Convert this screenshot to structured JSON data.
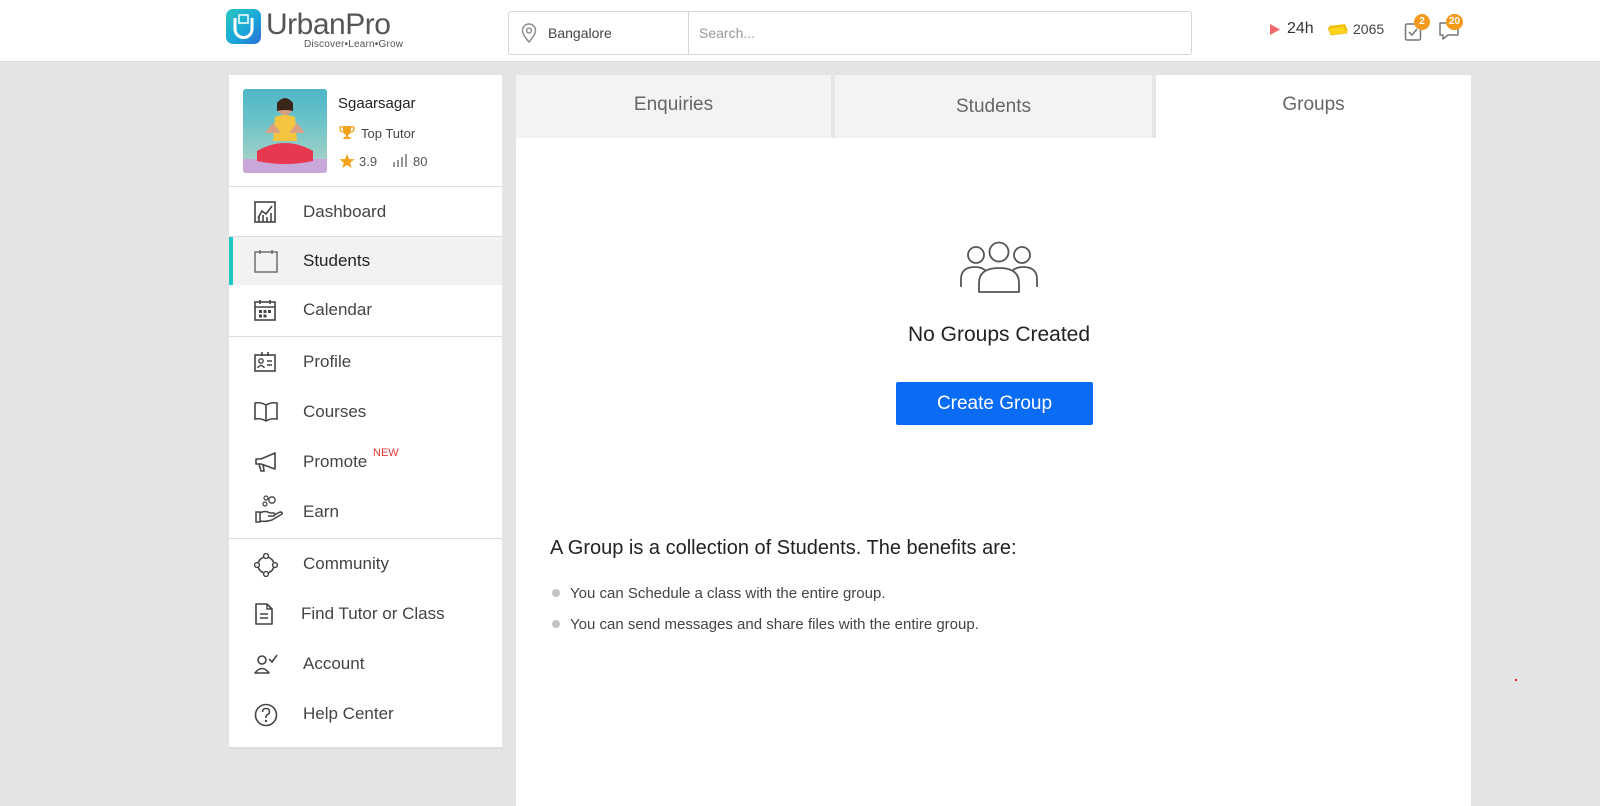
{
  "header": {
    "logo_name": "UrbanPro",
    "logo_tagline": "Discover•Learn•Grow",
    "location": "Bangalore",
    "search_placeholder": "Search...",
    "hours_label": "24h",
    "coins": "2065",
    "tasks_badge": "2",
    "messages_badge": "20"
  },
  "profile": {
    "name": "Sgaarsagar",
    "rank": "Top Tutor",
    "rating": "3.9",
    "count": "80"
  },
  "sidebar": {
    "items": [
      {
        "label": "Dashboard",
        "icon": "dashboard-chart-icon"
      },
      {
        "label": "Students",
        "icon": "students-calendar-icon",
        "active": true
      },
      {
        "label": "Calendar",
        "icon": "calendar-icon"
      },
      {
        "label": "Profile",
        "icon": "profile-card-icon"
      },
      {
        "label": "Courses",
        "icon": "book-icon"
      },
      {
        "label": "Promote",
        "icon": "megaphone-icon",
        "tag": "NEW"
      },
      {
        "label": "Earn",
        "icon": "hand-coins-icon"
      },
      {
        "label": "Community",
        "icon": "community-icon"
      },
      {
        "label": "Find Tutor or Class",
        "icon": "document-icon"
      },
      {
        "label": "Account",
        "icon": "account-check-icon"
      },
      {
        "label": "Help Center",
        "icon": "help-circle-icon"
      }
    ]
  },
  "tabs": [
    {
      "label": "Enquiries"
    },
    {
      "label": "Students"
    },
    {
      "label": "Groups",
      "active": true
    }
  ],
  "groups": {
    "empty_title": "No Groups Created",
    "create_button": "Create Group",
    "info_heading": "A Group is a collection of Students. The benefits are:",
    "benefits": [
      "You can Schedule a class with the entire group.",
      "You can send messages and share files with the entire group."
    ]
  },
  "colors": {
    "accent_teal": "#1ec6c0",
    "button_blue": "#0a6cf4",
    "badge_orange": "#f39a1d",
    "new_red": "#e53935"
  }
}
